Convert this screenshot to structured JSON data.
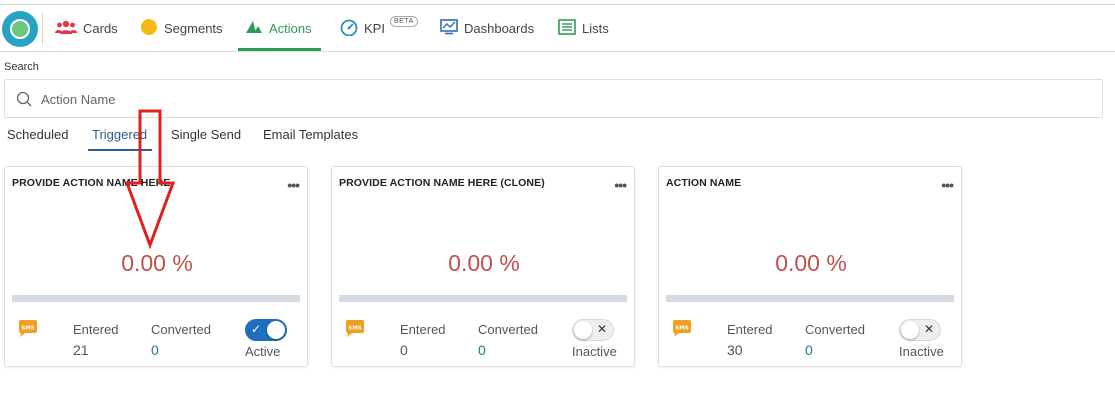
{
  "nav": {
    "items": [
      {
        "label": "Cards",
        "icon": "users-icon"
      },
      {
        "label": "Segments",
        "icon": "pie-chart-icon"
      },
      {
        "label": "Actions",
        "icon": "actions-icon"
      },
      {
        "label": "KPI",
        "icon": "gauge-icon",
        "badge": "BETA"
      },
      {
        "label": "Dashboards",
        "icon": "dashboard-icon"
      },
      {
        "label": "Lists",
        "icon": "list-icon"
      }
    ],
    "active": "Actions",
    "active_color": "#2e9b55"
  },
  "search": {
    "label": "Search",
    "placeholder": "Action Name",
    "value": ""
  },
  "tabs": {
    "items": [
      "Scheduled",
      "Triggered",
      "Single Send",
      "Email Templates"
    ],
    "active": "Triggered"
  },
  "cards": [
    {
      "title": "PROVIDE ACTION NAME HERE",
      "percent": "0.00 %",
      "entered_label": "Entered",
      "entered_value": "21",
      "converted_label": "Converted",
      "converted_value": "0",
      "status": "Active",
      "toggle_on": true,
      "channel_icon": "sms-icon"
    },
    {
      "title": "PROVIDE ACTION NAME HERE (CLONE)",
      "percent": "0.00 %",
      "entered_label": "Entered",
      "entered_value": "0",
      "converted_label": "Converted",
      "converted_value": "0",
      "status": "Inactive",
      "toggle_on": false,
      "channel_icon": "sms-icon"
    },
    {
      "title": "ACTION NAME",
      "percent": "0.00 %",
      "entered_label": "Entered",
      "entered_value": "30",
      "converted_label": "Converted",
      "converted_value": "0",
      "status": "Inactive",
      "toggle_on": false,
      "channel_icon": "sms-icon"
    }
  ],
  "colors": {
    "percent": "#c0504d",
    "toggle_on": "#1e6fbf",
    "annotation_arrow": "#e02020",
    "tab_active": "#2c5f8a"
  }
}
